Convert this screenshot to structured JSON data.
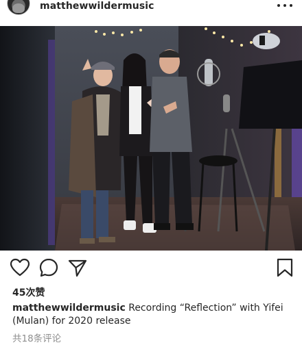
{
  "post": {
    "username": "matthewwildermusic",
    "likes": "45次赞",
    "caption_user": "matthewwildermusic",
    "caption_text": "Recording “Reflection” with Yifei (Mulan) for 2020 release",
    "comments": "共18条评论"
  },
  "icons": {
    "more": "more-horizontal-icon",
    "like": "heart-icon",
    "comment": "comment-bubble-icon",
    "share": "paper-plane-icon",
    "save": "bookmark-icon"
  },
  "colors": {
    "text": "#262626",
    "muted": "#8e8e8e"
  }
}
